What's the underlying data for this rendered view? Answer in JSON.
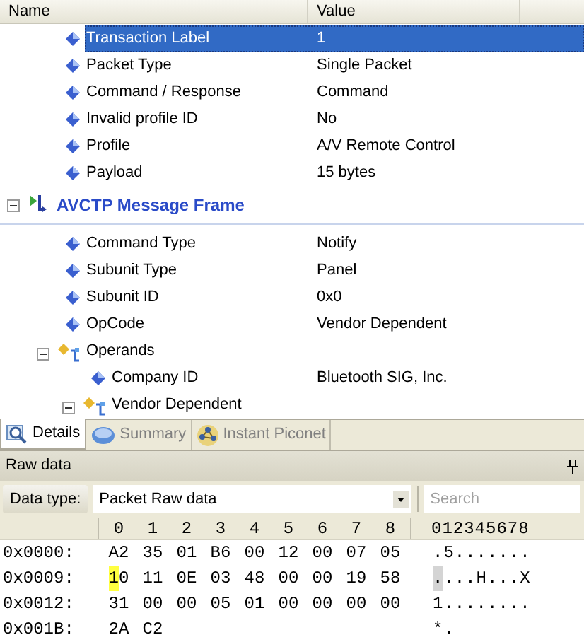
{
  "tree": {
    "columns": [
      "Name",
      "Value"
    ],
    "sections": [
      {
        "children": [
          {
            "kind": "field",
            "name": "Transaction Label",
            "value": "1",
            "selected": true
          },
          {
            "kind": "field",
            "name": "Packet Type",
            "value": "Single Packet",
            "selected": false
          },
          {
            "kind": "field",
            "name": "Command / Response",
            "value": "Command",
            "selected": false
          },
          {
            "kind": "field",
            "name": "Invalid profile ID",
            "value": "No",
            "selected": false
          },
          {
            "kind": "field",
            "name": "Profile",
            "value": "A/V Remote Control",
            "selected": false
          },
          {
            "kind": "field",
            "name": "Payload",
            "value": "15 bytes",
            "selected": false
          }
        ]
      },
      {
        "title": "AVCTP Message Frame",
        "expanded": true,
        "children": [
          {
            "kind": "field",
            "name": "Command Type",
            "value": "Notify",
            "selected": false
          },
          {
            "kind": "field",
            "name": "Subunit Type",
            "value": "Panel",
            "selected": false
          },
          {
            "kind": "field",
            "name": "Subunit ID",
            "value": "0x0",
            "selected": false
          },
          {
            "kind": "field",
            "name": "OpCode",
            "value": "Vendor Dependent",
            "selected": false
          },
          {
            "kind": "group",
            "name": "Operands",
            "expanded": true,
            "selected": false,
            "children": [
              {
                "kind": "field",
                "name": "Company ID",
                "value": "Bluetooth SIG, Inc.",
                "selected": false
              },
              {
                "kind": "group",
                "name": "Vendor Dependent",
                "expanded": true,
                "selected": false
              }
            ]
          }
        ]
      }
    ]
  },
  "tabs": [
    {
      "label": "Details",
      "selected": true
    },
    {
      "label": "Summary",
      "selected": false
    },
    {
      "label": "Instant Piconet",
      "selected": false
    }
  ],
  "raw_data": {
    "title": "Raw data",
    "data_type_label": "Data type:",
    "data_type": "Packet Raw data",
    "search": {
      "placeholder": "Search"
    },
    "hex_columns": [
      "0",
      "1",
      "2",
      "3",
      "4",
      "5",
      "6",
      "7",
      "8"
    ],
    "ascii_header": "012345678",
    "rows": [
      {
        "offset": "0x0000:",
        "bytes": [
          {
            "text": "A2",
            "highlighted": false
          },
          {
            "text": "35",
            "highlighted": false
          },
          {
            "text": "01",
            "highlighted": false
          },
          {
            "text": "B6",
            "highlighted": false
          },
          {
            "text": "00",
            "highlighted": false
          },
          {
            "text": "12",
            "highlighted": false
          },
          {
            "text": "00",
            "highlighted": false
          },
          {
            "text": "07",
            "highlighted": false
          },
          {
            "text": "05",
            "highlighted": false
          }
        ],
        "ascii": ".5.......",
        "ascii_highlighted": false
      },
      {
        "offset": "0x0009:",
        "bytes": [
          {
            "text": "10",
            "highlighted": true
          },
          {
            "text": "11",
            "highlighted": false
          },
          {
            "text": "0E",
            "highlighted": false
          },
          {
            "text": "03",
            "highlighted": false
          },
          {
            "text": "48",
            "highlighted": false
          },
          {
            "text": "00",
            "highlighted": false
          },
          {
            "text": "00",
            "highlighted": false
          },
          {
            "text": "19",
            "highlighted": false
          },
          {
            "text": "58",
            "highlighted": false
          }
        ],
        "ascii": "....H...X",
        "ascii_highlighted": true
      },
      {
        "offset": "0x0012:",
        "bytes": [
          {
            "text": "31",
            "highlighted": false
          },
          {
            "text": "00",
            "highlighted": false
          },
          {
            "text": "00",
            "highlighted": false
          },
          {
            "text": "05",
            "highlighted": false
          },
          {
            "text": "01",
            "highlighted": false
          },
          {
            "text": "00",
            "highlighted": false
          },
          {
            "text": "00",
            "highlighted": false
          },
          {
            "text": "00",
            "highlighted": false
          },
          {
            "text": "00",
            "highlighted": false
          }
        ],
        "ascii": "1........",
        "ascii_highlighted": false
      },
      {
        "offset": "0x001B:",
        "bytes": [
          {
            "text": "2A",
            "highlighted": false
          },
          {
            "text": "C2",
            "highlighted": false
          }
        ],
        "ascii": "*.",
        "ascii_highlighted": false
      }
    ]
  }
}
